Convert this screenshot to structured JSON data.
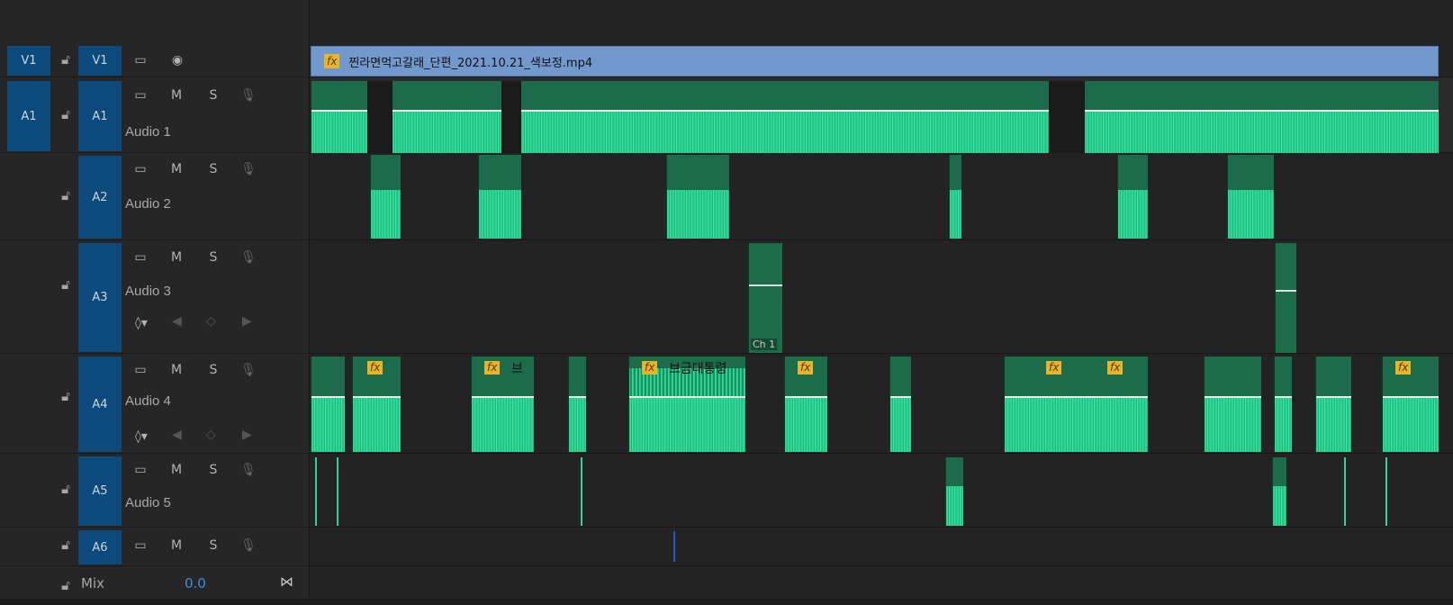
{
  "tracks": {
    "v1": {
      "source": "V1",
      "target": "V1"
    },
    "a1": {
      "source": "A1",
      "target": "A1",
      "name": "Audio 1"
    },
    "a2": {
      "target": "A2",
      "name": "Audio 2"
    },
    "a3": {
      "target": "A3",
      "name": "Audio 3"
    },
    "a4": {
      "target": "A4",
      "name": "Audio 4"
    },
    "a5": {
      "target": "A5",
      "name": "Audio 5"
    },
    "a6": {
      "target": "A6"
    }
  },
  "controls": {
    "mute": "M",
    "solo": "S"
  },
  "video_clip": {
    "fx": "fx",
    "name": "찐라면먹고갈래_단편_2021.10.21_색보정.mp4"
  },
  "audio4_clips": {
    "title1": "브",
    "title2": "브금대통령"
  },
  "audio3_clip": {
    "label": "Ch 1"
  },
  "mix": {
    "label": "Mix",
    "value": "0.0"
  },
  "colors": {
    "track_target_blue": "#0c4a7c",
    "video_clip": "#7199ce",
    "audio_clip": "#1c6b4b",
    "waveform": "#2fd596",
    "fx_badge": "#e8b52a"
  }
}
